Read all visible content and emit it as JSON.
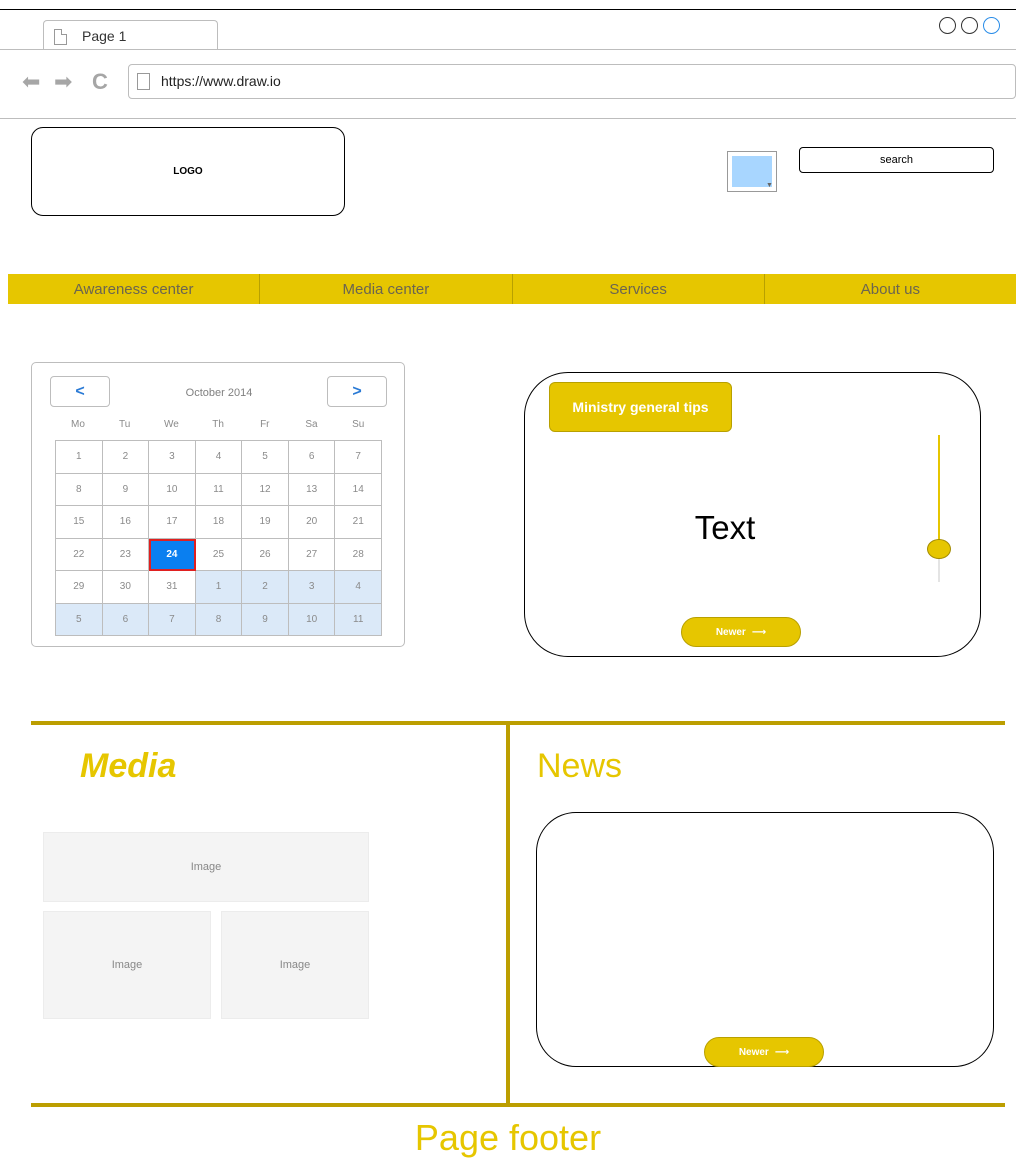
{
  "browser": {
    "tab_label": "Page 1",
    "url": "https://www.draw.io"
  },
  "header": {
    "logo_text": "LOGO",
    "search_text": "search"
  },
  "menu": [
    "Awareness center",
    "Media center",
    "Services",
    "About us"
  ],
  "calendar": {
    "month_label": "October 2014",
    "prev_label": "<",
    "next_label": ">",
    "weekdays": [
      "Mo",
      "Tu",
      "We",
      "Th",
      "Fr",
      "Sa",
      "Su"
    ],
    "weeks": [
      [
        "1",
        "2",
        "3",
        "4",
        "5",
        "6",
        "7"
      ],
      [
        "8",
        "9",
        "10",
        "11",
        "12",
        "13",
        "14"
      ],
      [
        "15",
        "16",
        "17",
        "18",
        "19",
        "20",
        "21"
      ],
      [
        "22",
        "23",
        "24",
        "25",
        "26",
        "27",
        "28"
      ],
      [
        "29",
        "30",
        "31",
        "1",
        "2",
        "3",
        "4"
      ],
      [
        "5",
        "6",
        "7",
        "8",
        "9",
        "10",
        "11"
      ]
    ],
    "selected_day": "24"
  },
  "tips": {
    "heading": "Ministry general tips",
    "body": "Text",
    "newer_label": "Newer"
  },
  "media": {
    "title": "Media",
    "images": [
      "Image",
      "Image",
      "Image"
    ]
  },
  "news": {
    "title": "News",
    "newer_label": "Newer"
  },
  "footer": {
    "text": "Page footer"
  },
  "colors": {
    "accent": "#e6c600",
    "rule": "#bc9e00",
    "selected_day": "#0a7ff0"
  }
}
